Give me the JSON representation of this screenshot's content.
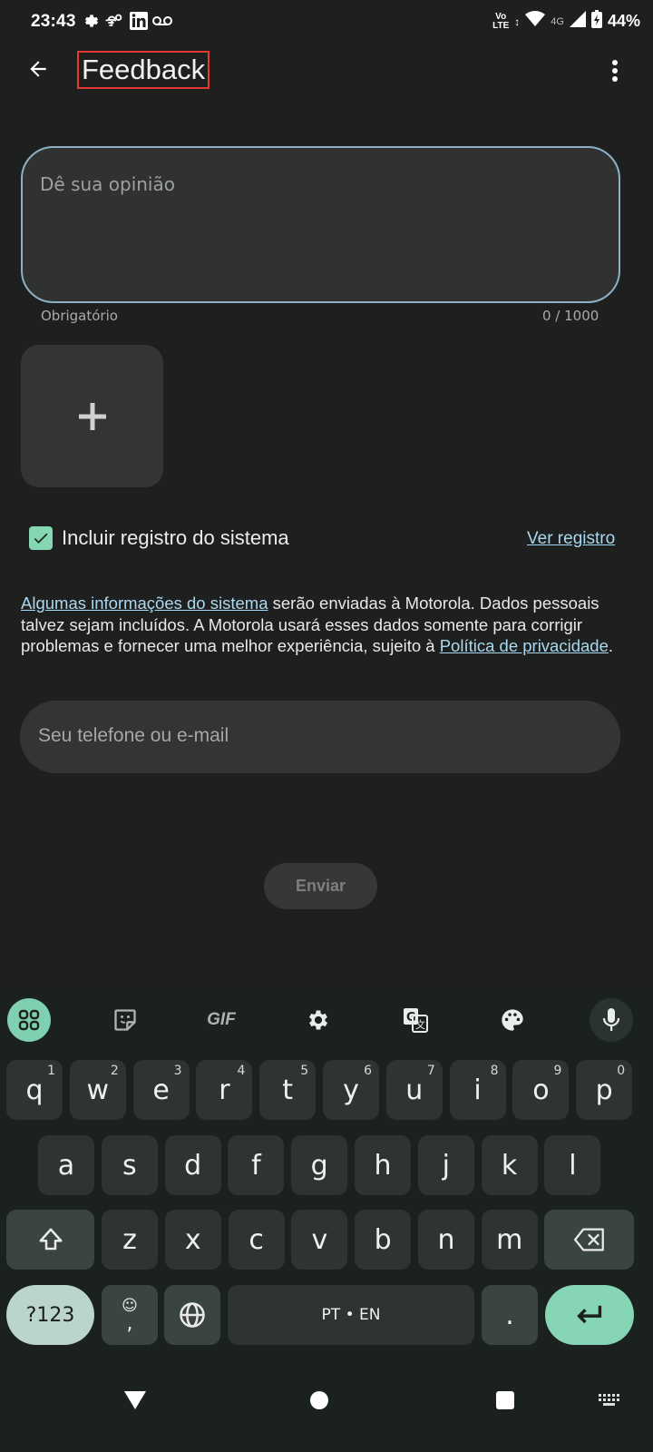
{
  "status_bar": {
    "time": "23:43",
    "battery": "44%",
    "network_label": "4G",
    "volte_label_top": "Vo",
    "volte_label_bottom": "LTE",
    "icons": [
      "settings-icon",
      "wifi-calling-icon",
      "linkedin-icon",
      "voicemail-icon",
      "signal-icon",
      "wifi-icon",
      "battery-charging-icon"
    ]
  },
  "app_bar": {
    "title": "Feedback",
    "back_icon": "arrow-back-icon",
    "more_icon": "more-vert-icon"
  },
  "form": {
    "opinion_placeholder": "Dê sua opinião",
    "required_label": "Obrigatório",
    "counter": "0 / 1000",
    "add_attachment_icon": "plus-icon",
    "include_log_label": "Incluir registro do sistema",
    "include_log_checked": true,
    "view_log_label": "Ver registro",
    "info_link_1": "Algumas informações do sistema",
    "info_text_1": " serão enviadas à Motorola. Dados pessoais talvez sejam incluídos. A Motorola usará esses dados somente para corrigir problemas e fornecer uma melhor experiência, sujeito à ",
    "info_link_2": "Política de privacidade",
    "info_text_2": ".",
    "contact_placeholder": "Seu telefone ou e-mail",
    "submit_label": "Enviar"
  },
  "keyboard": {
    "toolbar": [
      "apps-grid-icon",
      "sticker-icon",
      "gif-icon",
      "settings-icon",
      "translate-icon",
      "palette-icon",
      "mic-icon"
    ],
    "gif_label": "GIF",
    "row1": [
      {
        "k": "q",
        "n": "1"
      },
      {
        "k": "w",
        "n": "2"
      },
      {
        "k": "e",
        "n": "3"
      },
      {
        "k": "r",
        "n": "4"
      },
      {
        "k": "t",
        "n": "5"
      },
      {
        "k": "y",
        "n": "6"
      },
      {
        "k": "u",
        "n": "7"
      },
      {
        "k": "i",
        "n": "8"
      },
      {
        "k": "o",
        "n": "9"
      },
      {
        "k": "p",
        "n": "0"
      }
    ],
    "row2": [
      "a",
      "s",
      "d",
      "f",
      "g",
      "h",
      "j",
      "k",
      "l"
    ],
    "row3": [
      "z",
      "x",
      "c",
      "v",
      "b",
      "n",
      "m"
    ],
    "symbols_label": "?123",
    "emoji_comma_label": ",",
    "space_label": "PT • EN",
    "period_label": "."
  },
  "nav_bar": {
    "icons": [
      "back-triangle-icon",
      "home-circle-icon",
      "recents-square-icon",
      "keyboard-switch-icon"
    ]
  }
}
